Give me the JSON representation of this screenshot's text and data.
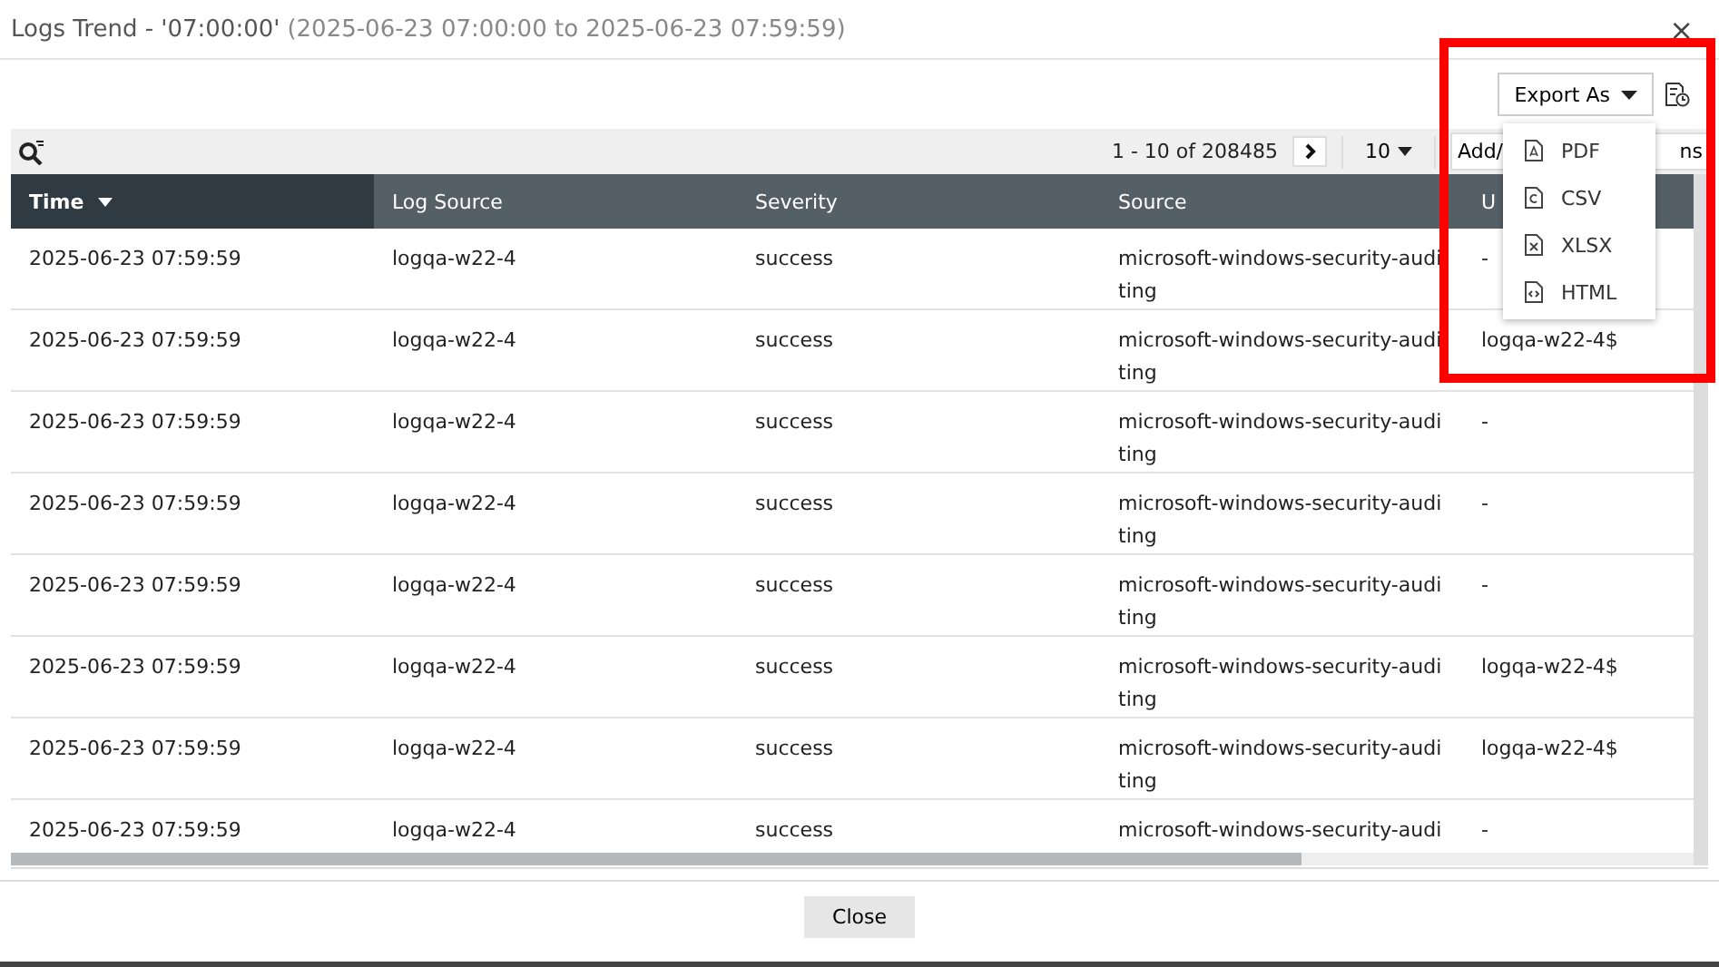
{
  "dialog": {
    "title": "Logs Trend - '07:00:00'",
    "subtitle": "(2025-06-23 07:00:00 to 2025-06-23 07:59:59)",
    "close_glyph": "×"
  },
  "export": {
    "label": "Export As",
    "menu_open": true,
    "items": [
      {
        "label": "PDF",
        "kind": "pdf"
      },
      {
        "label": "CSV",
        "kind": "csv"
      },
      {
        "label": "XLSX",
        "kind": "xlsx"
      },
      {
        "label": "HTML",
        "kind": "html"
      }
    ]
  },
  "pager": {
    "range": "1 - 10 of 208485",
    "page_size": "10",
    "add_columns_start": "Add/",
    "add_columns_end": "ns"
  },
  "table": {
    "columns": [
      {
        "label": "Time",
        "sorted": true
      },
      {
        "label": "Log Source",
        "sorted": false
      },
      {
        "label": "Severity",
        "sorted": false
      },
      {
        "label": "Source",
        "sorted": false
      },
      {
        "label": "U",
        "sorted": false
      }
    ],
    "rows": [
      [
        "2025-06-23 07:59:59",
        "logqa-w22-4",
        "success",
        "microsoft-windows-security-auditing",
        "-"
      ],
      [
        "2025-06-23 07:59:59",
        "logqa-w22-4",
        "success",
        "microsoft-windows-security-auditing",
        "logqa-w22-4$"
      ],
      [
        "2025-06-23 07:59:59",
        "logqa-w22-4",
        "success",
        "microsoft-windows-security-auditing",
        "-"
      ],
      [
        "2025-06-23 07:59:59",
        "logqa-w22-4",
        "success",
        "microsoft-windows-security-auditing",
        "-"
      ],
      [
        "2025-06-23 07:59:59",
        "logqa-w22-4",
        "success",
        "microsoft-windows-security-auditing",
        "-"
      ],
      [
        "2025-06-23 07:59:59",
        "logqa-w22-4",
        "success",
        "microsoft-windows-security-auditing",
        "logqa-w22-4$"
      ],
      [
        "2025-06-23 07:59:59",
        "logqa-w22-4",
        "success",
        "microsoft-windows-security-auditing",
        "logqa-w22-4$"
      ],
      [
        "2025-06-23 07:59:59",
        "logqa-w22-4",
        "success",
        "microsoft-windows-security-audi",
        "-"
      ]
    ]
  },
  "footer": {
    "button": "Close"
  }
}
